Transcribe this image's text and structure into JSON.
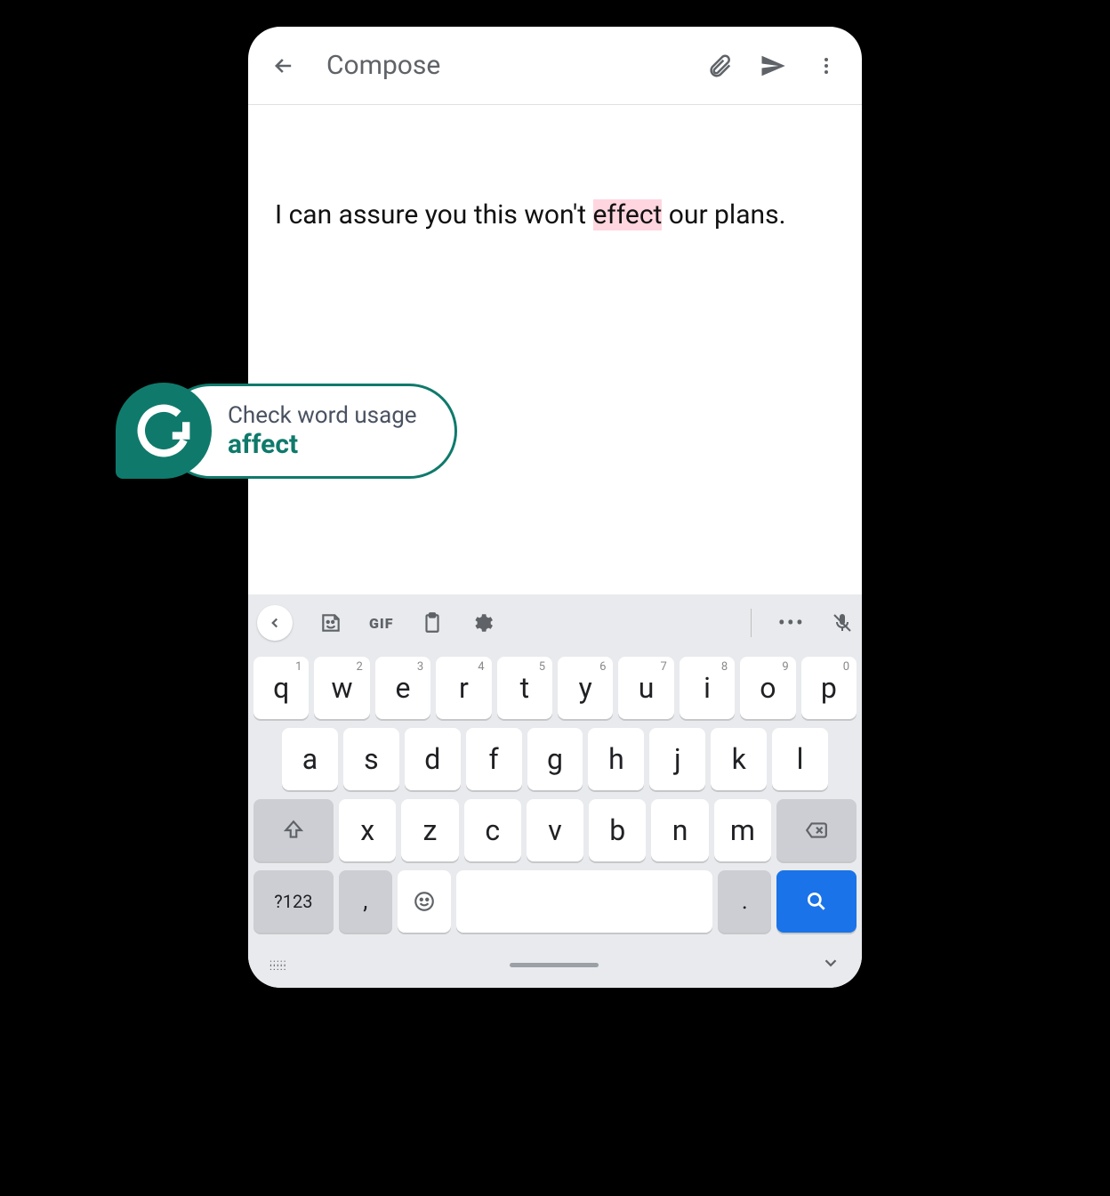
{
  "appbar": {
    "title": "Compose"
  },
  "message": {
    "before": "I can assure you this won't ",
    "highlight": "effect",
    "after": " our plans."
  },
  "suggestion": {
    "label": "Check word usage",
    "word": "affect"
  },
  "keyboard": {
    "toolbar": {
      "gif": "GIF"
    },
    "row1": [
      {
        "k": "q",
        "s": "1"
      },
      {
        "k": "w",
        "s": "2"
      },
      {
        "k": "e",
        "s": "3"
      },
      {
        "k": "r",
        "s": "4"
      },
      {
        "k": "t",
        "s": "5"
      },
      {
        "k": "y",
        "s": "6"
      },
      {
        "k": "u",
        "s": "7"
      },
      {
        "k": "i",
        "s": "8"
      },
      {
        "k": "o",
        "s": "9"
      },
      {
        "k": "p",
        "s": "0"
      }
    ],
    "row2": [
      "a",
      "s",
      "d",
      "f",
      "g",
      "h",
      "j",
      "k",
      "l"
    ],
    "row3": [
      "x",
      "z",
      "c",
      "v",
      "b",
      "n",
      "m"
    ],
    "row4": {
      "sym": "?123",
      "comma": ",",
      "period": "."
    }
  }
}
